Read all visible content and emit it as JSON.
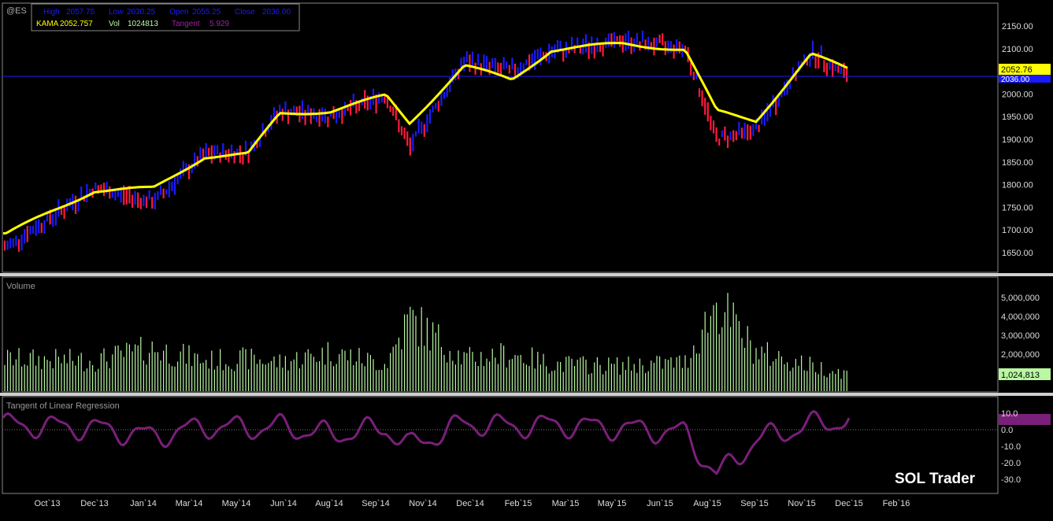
{
  "symbol": "@ES",
  "info_line1": [
    {
      "label": "High",
      "value": "2057.75"
    },
    {
      "label": "Low",
      "value": "2030.25"
    },
    {
      "label": "Open",
      "value": "2055.25"
    },
    {
      "label": "Close",
      "value": "2036.00"
    }
  ],
  "info_line2": [
    {
      "label": "KAMA",
      "value": "2052.757",
      "color": "#ffff00"
    },
    {
      "label": "Vol",
      "value": "1024813",
      "color": "#b9f7a3"
    },
    {
      "label": "Tangent",
      "value": "5.929",
      "color": "#a020a0"
    }
  ],
  "price_axis_ticks": [
    "2150.00",
    "2100.00",
    "2050.00",
    "2000.00",
    "1950.00",
    "1900.00",
    "1850.00",
    "1800.00",
    "1750.00",
    "1700.00",
    "1650.00"
  ],
  "kama_badge": "2052.76",
  "close_badge": "2036.00",
  "volume_panel": {
    "title": "Volume",
    "ticks": [
      "5,000,000",
      "4,000,000",
      "3,000,000",
      "2,000,000"
    ],
    "badge": "1,024,813"
  },
  "tangent_panel": {
    "title": "Tangent of Linear Regression",
    "ticks": [
      "10.0",
      "0.0",
      "-10.0",
      "-20.0",
      "-30.0"
    ]
  },
  "watermark": "SOL Trader",
  "time_axis": [
    "Oct`13",
    "Dec`13",
    "Jan`14",
    "Mar`14",
    "May`14",
    "Jun`14",
    "Aug`14",
    "Sep`14",
    "Nov`14",
    "Dec`14",
    "Feb`15",
    "Mar`15",
    "May`15",
    "Jun`15",
    "Aug`15",
    "Sep`15",
    "Nov`15",
    "Dec`15",
    "Feb`16"
  ],
  "colors": {
    "up_bar": "#1a1aff",
    "down_bar": "#ff1a3c",
    "kama": "#ffff00",
    "volume": "#b9f7a3",
    "tangent": "#7a1f7a",
    "close_line": "#1a1aff"
  },
  "chart_data": [
    {
      "type": "line",
      "title": "@ES",
      "ylim": [
        1620,
        2180
      ],
      "x": [
        "Oct`13",
        "Dec`13",
        "Jan`14",
        "Mar`14",
        "May`14",
        "Jun`14",
        "Aug`14",
        "Sep`14",
        "Nov`14",
        "Dec`14",
        "Feb`15",
        "Mar`15",
        "May`15",
        "Jun`15",
        "Aug`15",
        "Sep`15",
        "Nov`15",
        "Dec`15"
      ],
      "series": [
        {
          "name": "KAMA",
          "values": [
            1690,
            1785,
            1790,
            1860,
            1865,
            1955,
            1960,
            1995,
            1935,
            2060,
            2030,
            2095,
            2110,
            2095,
            1960,
            1940,
            2085,
            2053
          ]
        },
        {
          "values": [
            1660,
            1790,
            1760,
            1865,
            1870,
            1960,
            1950,
            1995,
            1880,
            2070,
            2050,
            2090,
            2115,
            2100,
            1900,
            1920,
            2090,
            2036
          ]
        }
      ]
    },
    {
      "type": "bar",
      "title": "Volume",
      "ylim": [
        0,
        5500000
      ],
      "x": [
        "Oct`13",
        "Dec`13",
        "Jan`14",
        "Mar`14",
        "May`14",
        "Jun`14",
        "Aug`14",
        "Sep`14",
        "Nov`14",
        "Dec`14",
        "Feb`15",
        "Mar`15",
        "May`15",
        "Jun`15",
        "Aug`15",
        "Sep`15",
        "Nov`15",
        "Dec`15"
      ],
      "series": [
        {
          "name": "Volume",
          "values": [
            1900000,
            1800000,
            2500000,
            1800000,
            1900000,
            1700000,
            2300000,
            1600000,
            4300000,
            1900000,
            2200000,
            1600000,
            1500000,
            1700000,
            5200000,
            2300000,
            1500000,
            1024813
          ]
        }
      ]
    },
    {
      "type": "line",
      "title": "Tangent of Linear Regression",
      "ylim": [
        -35,
        15
      ],
      "x": [
        "Oct`13",
        "Dec`13",
        "Jan`14",
        "Mar`14",
        "May`14",
        "Jun`14",
        "Aug`14",
        "Sep`14",
        "Nov`14",
        "Dec`14",
        "Feb`15",
        "Mar`15",
        "May`15",
        "Jun`15",
        "Aug`15",
        "Sep`15",
        "Nov`15",
        "Dec`15"
      ],
      "series": [
        {
          "name": "Tangent",
          "values": [
            3,
            1,
            -4,
            2,
            1,
            2,
            -3,
            1,
            -10,
            4,
            2,
            3,
            1,
            -2,
            -28,
            -6,
            3,
            5.929
          ]
        }
      ]
    }
  ]
}
